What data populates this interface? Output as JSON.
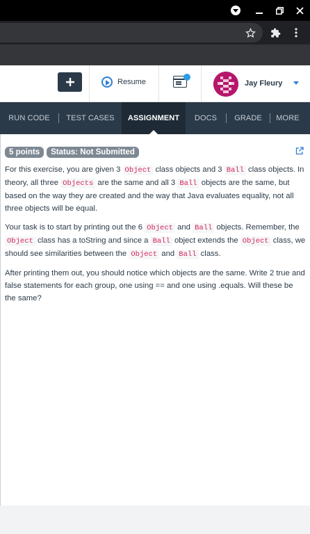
{
  "browser": {
    "window_controls": [
      "minimize",
      "maximize",
      "close"
    ]
  },
  "header": {
    "resume_label": "Resume",
    "user_name": "Jay Fleury",
    "notification_color": "#2b9ce8",
    "brand_color": "#2b3a48",
    "accent_color": "#2f7fd1"
  },
  "tabs": [
    {
      "label": "RUN CODE",
      "active": false
    },
    {
      "label": "TEST CASES",
      "active": false
    },
    {
      "label": "ASSIGNMENT",
      "active": true
    },
    {
      "label": "DOCS",
      "active": false
    },
    {
      "label": "GRADE",
      "active": false
    },
    {
      "label": "MORE",
      "active": false
    }
  ],
  "assignment": {
    "points": "5 points",
    "status": "Status: Not Submitted",
    "p1": {
      "t1": "For this exercise, you are given 3 ",
      "c1": "Object",
      "t2": " class objects and 3 ",
      "c2": "Ball",
      "t3": " class objects. In theory, all three ",
      "c3": "Objects",
      "t4": " are the same and all 3 ",
      "c4": "Ball",
      "t5": " objects are the same, but based on the way they are created and the way that Java evaluates equality, not all three objects will be equal."
    },
    "p2": {
      "t1": "Your task is to start by printing out the 6 ",
      "c1": "Object",
      "t2": " and ",
      "c2": "Ball",
      "t3": " objects. Remember, the ",
      "c3": "Object",
      "t4": " class has a toString and since a ",
      "c4": "Ball",
      "t5": " object extends the ",
      "c5": "Object",
      "t6": " class, we should see similarities between the ",
      "c6": "Object",
      "t7": " and ",
      "c7": "Ball",
      "t8": " class."
    },
    "p3": "After printing them out, you should notice which objects are the same. Write 2 true and false statements for each group, one using == and one using .equals. Will these be the same?"
  }
}
